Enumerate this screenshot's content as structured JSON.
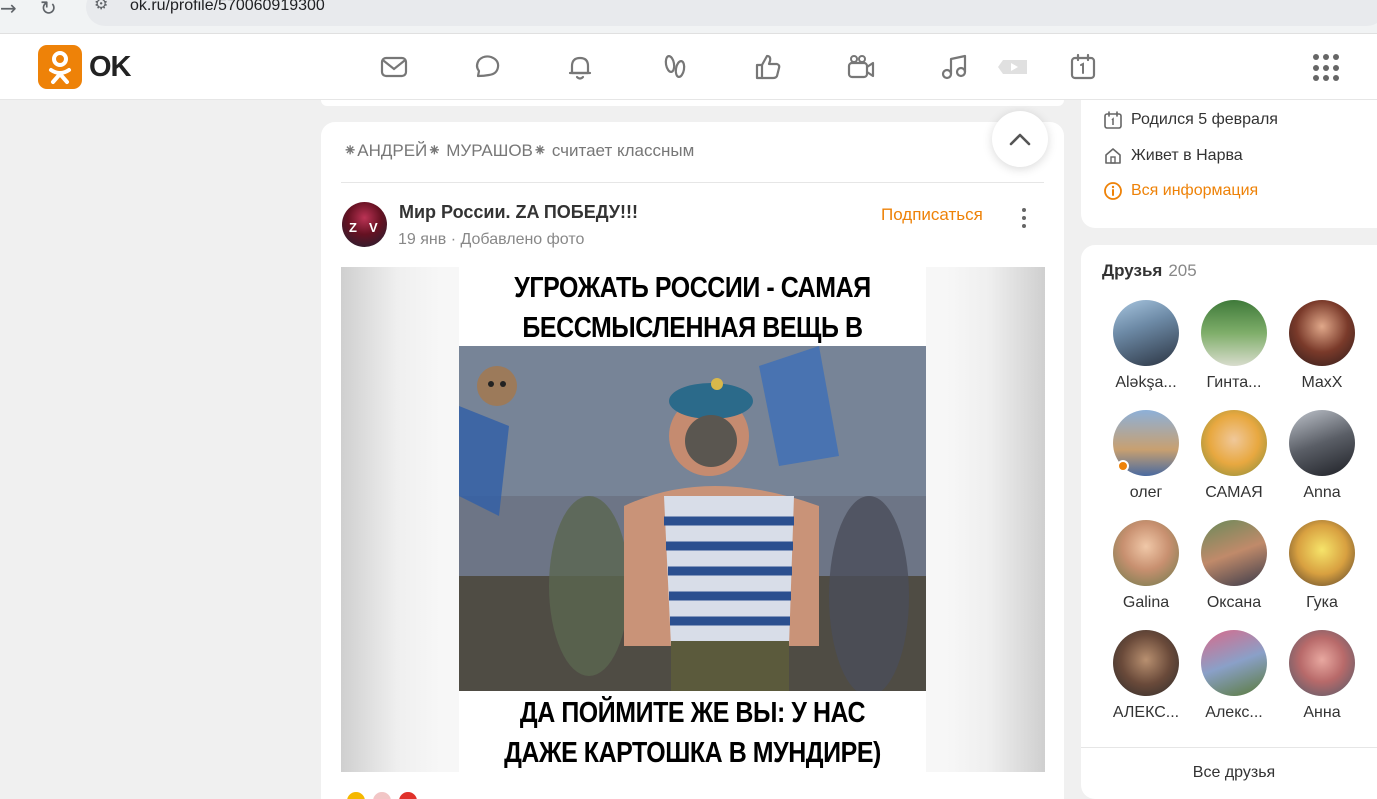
{
  "browser": {
    "url": "ok.ru/profile/570060919300"
  },
  "header": {
    "logo_text": "OK",
    "nav_icons": [
      "mail-icon",
      "chat-icon",
      "bell-icon",
      "guests-icon",
      "like-icon",
      "video-camera-icon",
      "music-icon",
      "video-play-icon",
      "calendar-icon"
    ],
    "apps_icon": "apps-grid-icon"
  },
  "feed": {
    "liker_text": "⁕АНДРЕЙ⁕ МУРАШОВ⁕ считает классным",
    "post": {
      "group_name": "Мир России. ZA ПОБЕДУ!!!",
      "date": "19 янв",
      "separator": "·",
      "action": "Добавлено фото",
      "subscribe_label": "Подписаться",
      "meme_top_line1": "УГРОЖАТЬ РОССИИ - САМАЯ",
      "meme_top_line2": "БЕССМЫСЛЕННАЯ ВЕЩЬ В МИРЕ",
      "meme_bottom_line1": "ДА ПОЙМИТЕ ЖЕ ВЫ: У НАС",
      "meme_bottom_line2": "ДАЖЕ КАРТОШКА В МУНДИРЕ)"
    }
  },
  "profile_info": {
    "birthday": "Родился 5 февраля",
    "lives": "Живет в Нарва",
    "all_info": "Вся информация"
  },
  "friends": {
    "title": "Друзья",
    "count": "205",
    "all_label": "Все друзья",
    "items": [
      {
        "name": "Aləkşa..."
      },
      {
        "name": "Гинта..."
      },
      {
        "name": "MaxX"
      },
      {
        "name": "олег"
      },
      {
        "name": "САМАЯ"
      },
      {
        "name": "Anna"
      },
      {
        "name": "Galina"
      },
      {
        "name": "Оксана"
      },
      {
        "name": "Гука"
      },
      {
        "name": "АЛЕКС..."
      },
      {
        "name": "Алекс..."
      },
      {
        "name": "Анна"
      }
    ]
  },
  "colors": {
    "accent": "#ee8208",
    "background": "#f0f0f0",
    "card": "#ffffff"
  }
}
